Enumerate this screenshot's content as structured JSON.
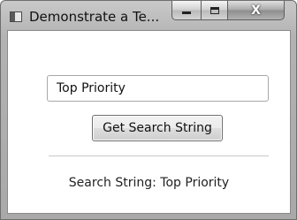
{
  "window": {
    "title": "Demonstrate a Te...",
    "close_glyph": "X"
  },
  "search": {
    "value": "Top Priority"
  },
  "button": {
    "label": "Get Search String"
  },
  "result": {
    "text": "Search String: Top Priority"
  },
  "icons": [
    "app-icon",
    "minimize-icon",
    "maximize-icon",
    "close-icon"
  ],
  "colors": {
    "frame": "#b3b3b3",
    "client_bg": "#ffffff"
  }
}
